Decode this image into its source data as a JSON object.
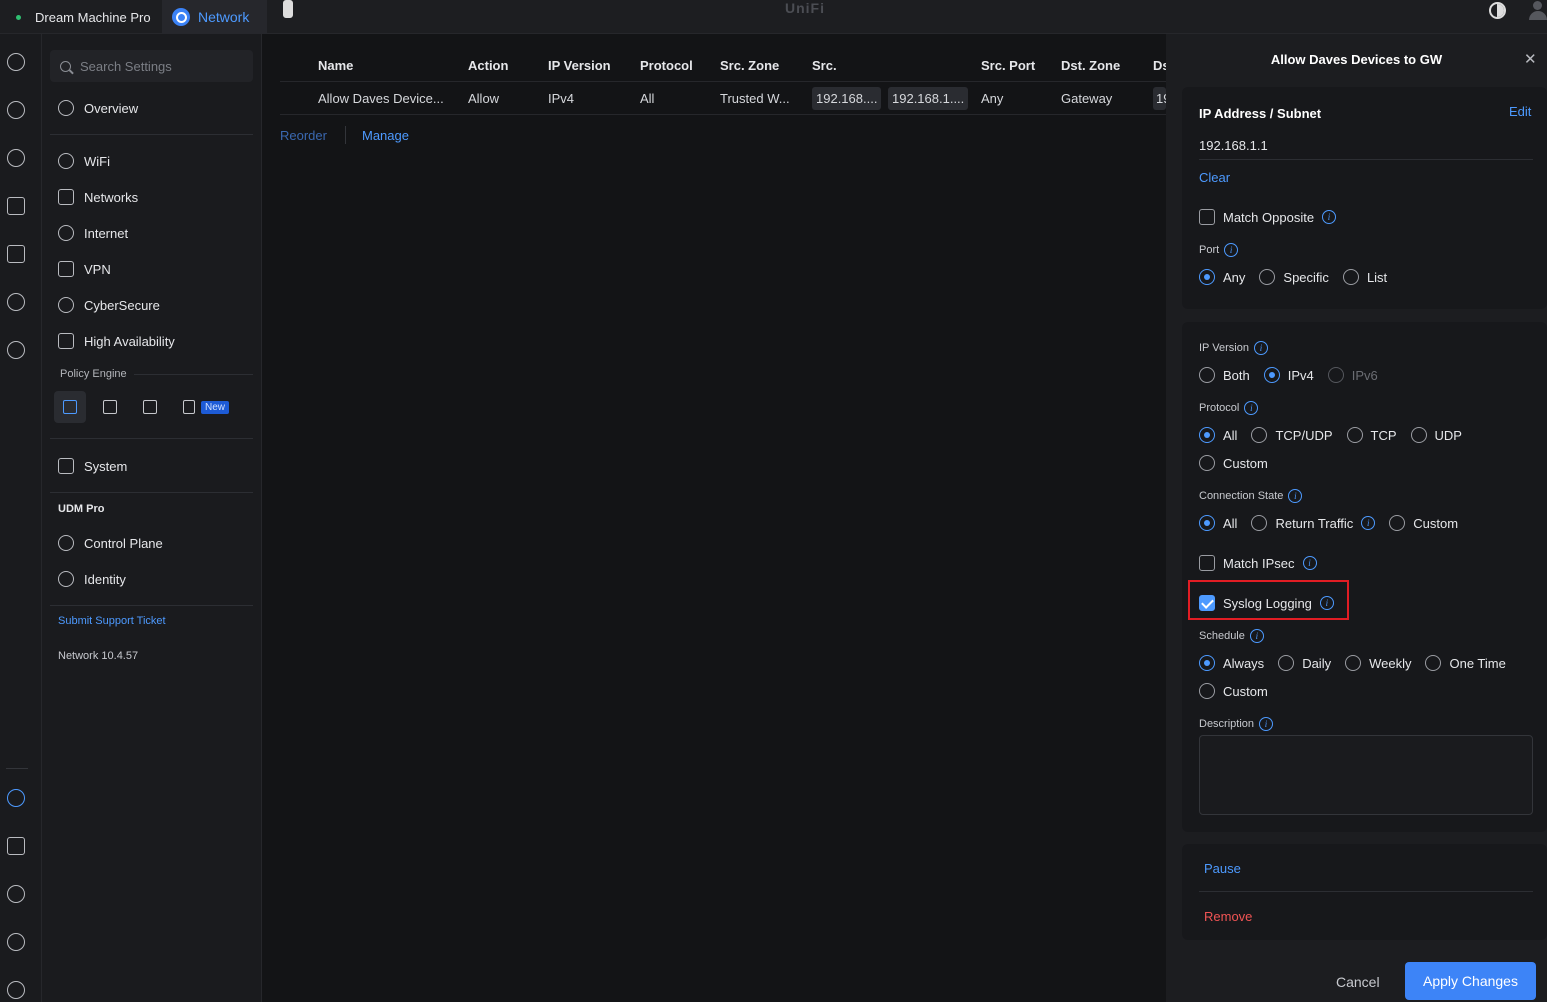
{
  "topbar": {
    "device_name": "Dream Machine Pro",
    "app_tab": "Network",
    "brand": "UniFi"
  },
  "settings_nav": {
    "search_placeholder": "Search Settings",
    "items": [
      {
        "label": "Overview",
        "icon": "overview-icon"
      },
      {
        "label": "WiFi",
        "icon": "wifi-icon"
      },
      {
        "label": "Networks",
        "icon": "networks-icon"
      },
      {
        "label": "Internet",
        "icon": "globe-icon"
      },
      {
        "label": "VPN",
        "icon": "vpn-icon"
      },
      {
        "label": "CyberSecure",
        "icon": "shield-icon"
      },
      {
        "label": "High Availability",
        "icon": "pulse-icon"
      }
    ],
    "policy_engine_label": "Policy Engine",
    "new_badge": "New",
    "system_label": "System",
    "device_section": "UDM Pro",
    "device_items": [
      {
        "label": "Control Plane",
        "icon": "control-plane-icon"
      },
      {
        "label": "Identity",
        "icon": "fingerprint-icon"
      }
    ],
    "support_link": "Submit Support Ticket",
    "version": "Network 10.4.57"
  },
  "table": {
    "columns": [
      "Name",
      "Action",
      "IP Version",
      "Protocol",
      "Src. Zone",
      "Src.",
      "Src. Port",
      "Dst. Zone",
      "Ds"
    ],
    "row": {
      "name": "Allow Daves Device...",
      "action": "Allow",
      "ip_version": "IPv4",
      "protocol": "All",
      "src_zone": "Trusted W...",
      "src_chips": [
        "192.168....",
        "192.168.1...."
      ],
      "src_port": "Any",
      "dst_zone": "Gateway",
      "dst_trunc": "19"
    },
    "reorder_label": "Reorder",
    "manage_label": "Manage"
  },
  "panel": {
    "title": "Allow Daves Devices to GW",
    "ip_subnet_label": "IP Address / Subnet",
    "edit_label": "Edit",
    "ip_value": "192.168.1.1",
    "clear_label": "Clear",
    "match_opposite_label": "Match Opposite",
    "port_label": "Port",
    "port_options": [
      "Any",
      "Specific",
      "List"
    ],
    "port_selected": "Any",
    "ip_version_label": "IP Version",
    "ip_version_options": [
      "Both",
      "IPv4",
      "IPv6"
    ],
    "ip_version_selected": "IPv4",
    "protocol_label": "Protocol",
    "protocol_options": [
      "All",
      "TCP/UDP",
      "TCP",
      "UDP"
    ],
    "protocol_custom": "Custom",
    "protocol_selected": "All",
    "conn_state_label": "Connection State",
    "conn_state_options": [
      "All",
      "Return Traffic",
      "Custom"
    ],
    "conn_state_selected": "All",
    "match_ipsec_label": "Match IPsec",
    "match_ipsec_checked": false,
    "syslog_label": "Syslog Logging",
    "syslog_checked": true,
    "schedule_label": "Schedule",
    "schedule_options": [
      "Always",
      "Daily",
      "Weekly",
      "One Time"
    ],
    "schedule_custom": "Custom",
    "schedule_selected": "Always",
    "description_label": "Description",
    "description_value": "",
    "pause_label": "Pause",
    "remove_label": "Remove",
    "cancel_label": "Cancel",
    "apply_label": "Apply Changes"
  },
  "colors": {
    "accent": "#3d84f7",
    "danger": "#f05454",
    "highlight": "#e11d24",
    "status_online": "#2fbf71"
  }
}
